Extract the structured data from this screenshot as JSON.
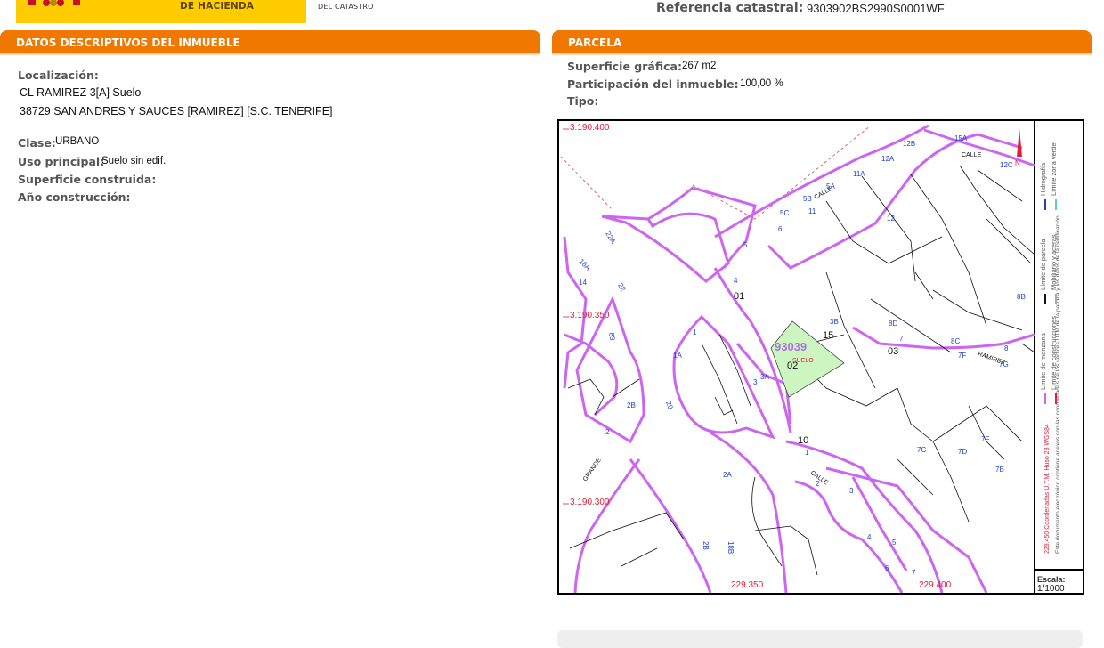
{
  "header": {
    "ministry_line": "DE HACIENDA",
    "agency_line": "DEL CATASTRO",
    "ref_label": "Referencia catastral:",
    "ref_value": "9303902BS2990S0001WF",
    "colors": {
      "band": "#ffcc00",
      "section": "#f07800"
    }
  },
  "datos": {
    "title": "DATOS DESCRIPTIVOS DEL INMUEBLE",
    "localizacion_label": "Localización:",
    "address_line1": "CL RAMIREZ 3[A] Suelo",
    "address_line2": "38729 SAN ANDRES Y SAUCES [RAMIREZ] [S.C. TENERIFE]",
    "clase_label": "Clase:",
    "clase_value": "URBANO",
    "uso_label": "Uso principal:",
    "uso_value": "Suelo sin edif.",
    "superficie_label": "Superficie construida:",
    "anio_label": "Año construcción:"
  },
  "parcela": {
    "title": "PARCELA",
    "superficie_label": "Superficie gráfica:",
    "superficie_value": "267 m2",
    "participacion_label": "Participación del inmueble:",
    "participacion_value": "100,00 %",
    "tipo_label": "Tipo:"
  },
  "map": {
    "coords": {
      "y_top": "3.190.400",
      "y_mid": "3.190.350",
      "y_low": "3.190.300",
      "x_left": "229.350",
      "x_right": "229.400",
      "x_corner": "229.450"
    },
    "parcel_id": "93039",
    "parcel_num": "02",
    "parcel_use": "SUELO",
    "other_nums": [
      "01",
      "15",
      "03",
      "10"
    ],
    "streets": [
      "CALLE",
      "CALLE",
      "CALLE",
      "RAMIREZ",
      "GRANDE"
    ],
    "portal_labels": [
      "15A",
      "12C",
      "12B",
      "12A",
      "11A",
      "5A",
      "5B",
      "5C",
      "6",
      "11",
      "12",
      "5",
      "4",
      "1",
      "1A",
      "3A",
      "3",
      "3B",
      "8D",
      "8C",
      "8B",
      "8",
      "7F",
      "7G",
      "7",
      "7C",
      "7D",
      "7F",
      "7B",
      "22A",
      "16A",
      "14",
      "22",
      "83",
      "2",
      "2B",
      "20",
      "2A",
      "18B",
      "2B",
      "1",
      "2",
      "3",
      "4",
      "5",
      "6",
      "7"
    ],
    "legend": {
      "hidrografia": "Hidrografía",
      "zona_verde": "Límite zona verde",
      "parcela": "Límite de parcela",
      "mobiliario": "Mobiliario y aceras",
      "manzana": "Límite de manzana",
      "construcciones": "Límite de construcciones",
      "coords_note": "229.450 Coordenadas U.T.M. Huso 28 WGS84",
      "doc_note": "Este documento electrónico contiene anexos con las coordenadas de los vértices UTM de la parcela y los datos de la certificación"
    },
    "scale_label": "Escala:",
    "scale_value": "1/1000",
    "north_label": "N",
    "colors": {
      "manzana": "#cc66ee",
      "portal": "#1f3fcc",
      "coord": "#e0203a",
      "parcel_fill": "#ccf5c0",
      "parcel_text": "#b070e0"
    }
  }
}
